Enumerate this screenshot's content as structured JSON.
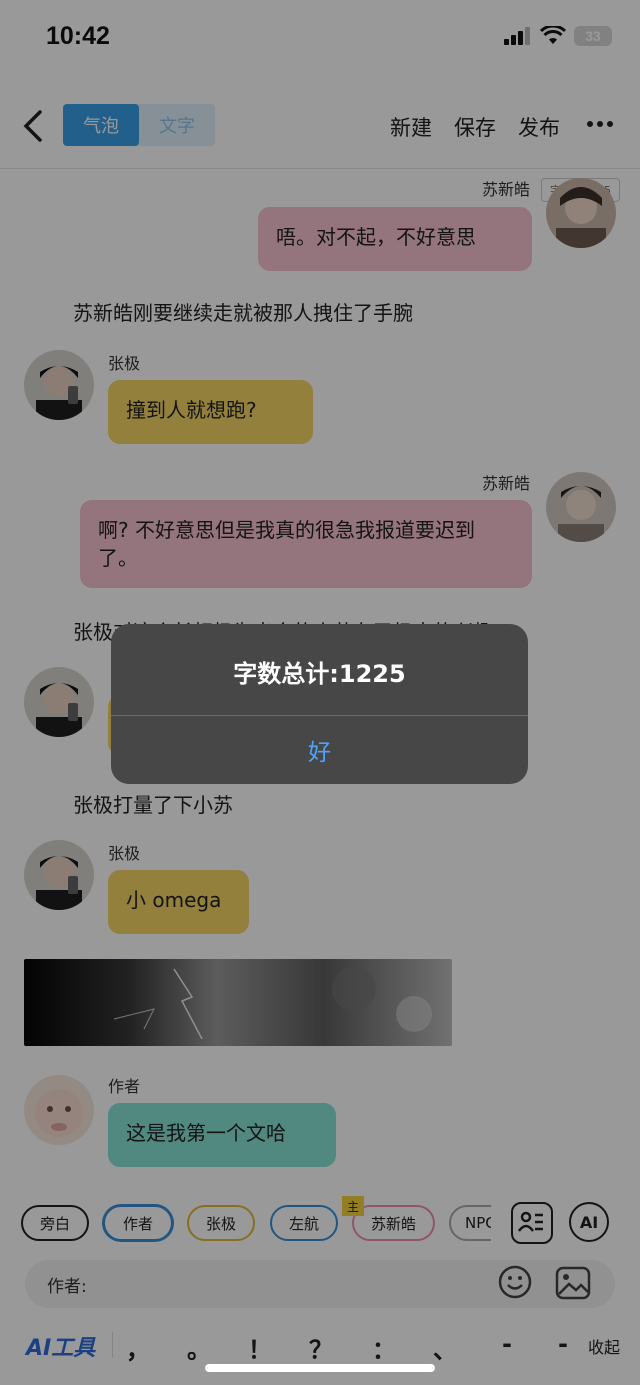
{
  "status": {
    "time": "10:42",
    "battery": "33"
  },
  "nav": {
    "tabs": [
      {
        "label": "气泡"
      },
      {
        "label": "文字"
      }
    ],
    "actions": [
      {
        "label": "新建"
      },
      {
        "label": "保存"
      },
      {
        "label": "发布"
      }
    ],
    "more_icon": "more-icon"
  },
  "word_count_badge": "字数：1225",
  "messages": [
    {
      "type": "bubble",
      "side": "right",
      "name": "苏新皓",
      "text": "唔。对不起，不好意思"
    },
    {
      "type": "narration",
      "text": "苏新皓刚要继续走就被那人拽住了手腕"
    },
    {
      "type": "bubble",
      "side": "left",
      "name": "张极",
      "text": "撞到人就想跑?"
    },
    {
      "type": "bubble",
      "side": "right",
      "name": "苏新皓",
      "text": "啊? 不好意思但是我真的很急我报道要迟到了。"
    },
    {
      "type": "narration",
      "text": "张极对这个长相极为出众的小苏有了极大的兴趣"
    },
    {
      "type": "narration",
      "text": "张极打量了下小苏"
    },
    {
      "type": "bubble",
      "side": "left",
      "name": "张极",
      "text": "小 omega"
    },
    {
      "type": "bubble",
      "side": "left",
      "name": "作者",
      "text": "这是我第一个文哈"
    }
  ],
  "dialog": {
    "title": "字数总计:1225",
    "button": "好"
  },
  "bottom": {
    "chips": [
      {
        "label": "旁白",
        "color": "#222222"
      },
      {
        "label": "作者",
        "color": "#3a8fd8"
      },
      {
        "label": "张极",
        "color": "#e2b93a"
      },
      {
        "label": "左航",
        "color": "#3a8fd8"
      },
      {
        "label": "苏新皓",
        "color": "#ef8fa8"
      },
      {
        "label": "NPC",
        "color": "#aaaaaa"
      }
    ],
    "main_badge": "主",
    "ai_button": "AI",
    "input_label": "作者:",
    "input_value": "",
    "ai_tools": "AI工具",
    "punctuation": [
      "，",
      "。",
      "！",
      "？",
      "：",
      "、",
      "-",
      "-"
    ],
    "collapse": "收起"
  },
  "colors": {
    "accent": "#3aa0e8",
    "bubble_pink": "#f9c3d0",
    "bubble_yellow": "#f6d665",
    "bubble_teal": "#88e3d6",
    "dialog_bg": "#474747",
    "dialog_button": "#4ea3ff"
  }
}
